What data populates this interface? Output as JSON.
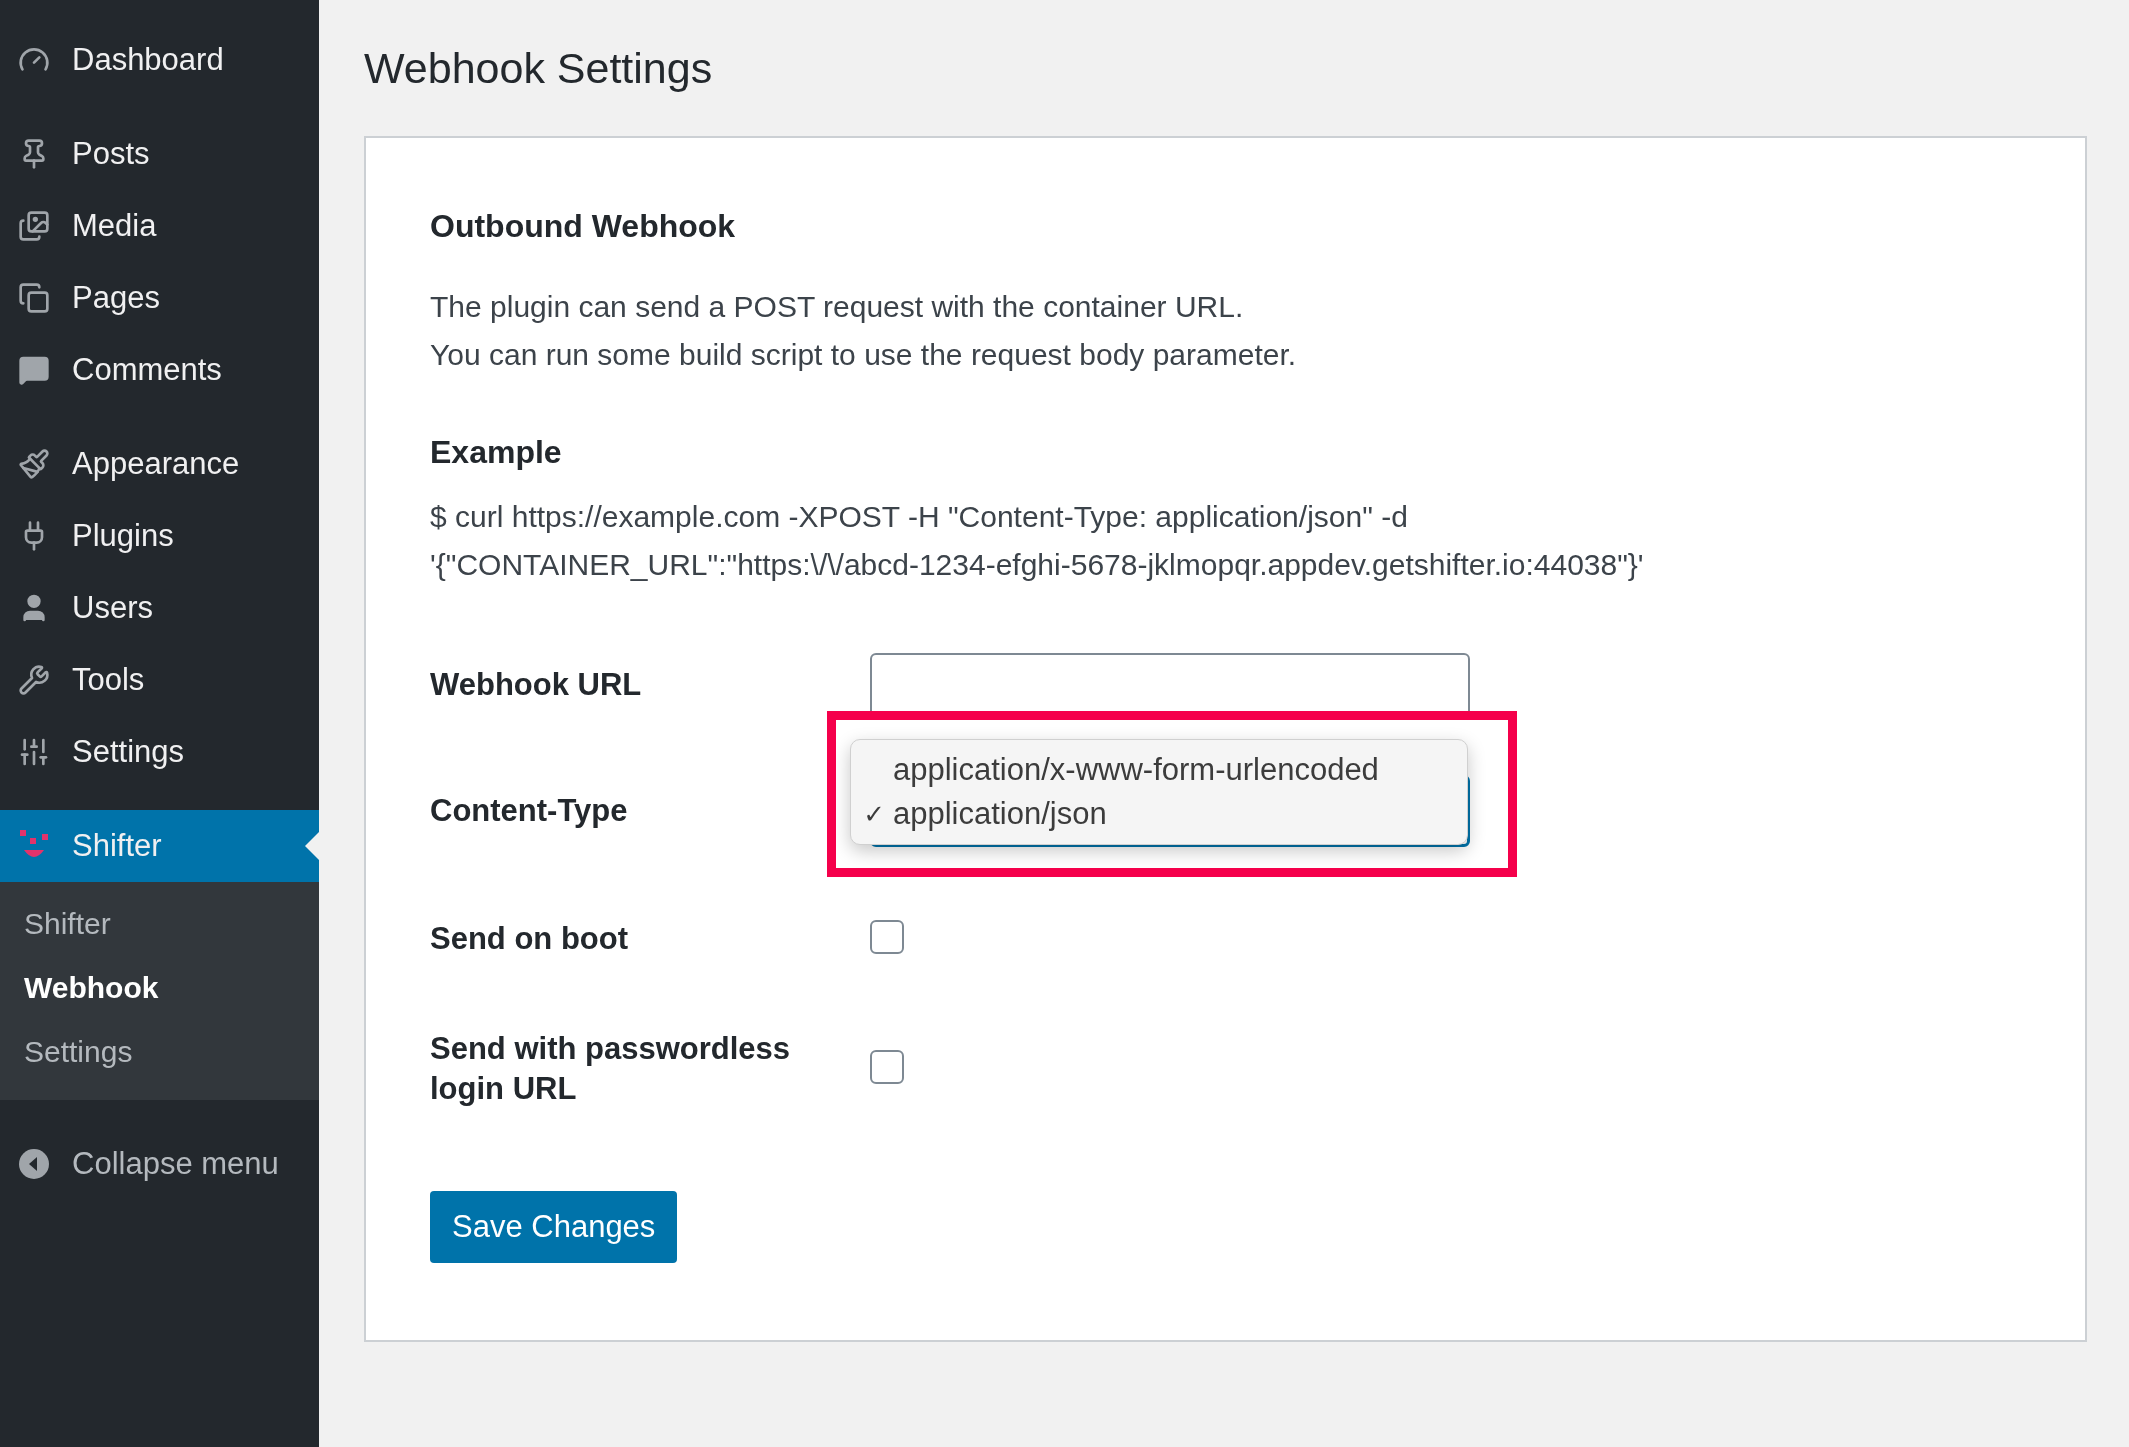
{
  "sidebar": {
    "groups": [
      {
        "items": [
          {
            "label": "Dashboard",
            "selected": false
          }
        ]
      },
      {
        "items": [
          {
            "label": "Posts",
            "selected": false
          },
          {
            "label": "Media",
            "selected": false
          },
          {
            "label": "Pages",
            "selected": false
          },
          {
            "label": "Comments",
            "selected": false
          }
        ]
      },
      {
        "items": [
          {
            "label": "Appearance",
            "selected": false
          },
          {
            "label": "Plugins",
            "selected": false
          },
          {
            "label": "Users",
            "selected": false
          },
          {
            "label": "Tools",
            "selected": false
          },
          {
            "label": "Settings",
            "selected": false
          }
        ]
      },
      {
        "items": [
          {
            "label": "Shifter",
            "selected": true,
            "children": [
              {
                "label": "Shifter",
                "selected": false
              },
              {
                "label": "Webhook",
                "selected": true
              },
              {
                "label": "Settings",
                "selected": false
              }
            ]
          }
        ]
      }
    ],
    "collapse": "Collapse menu"
  },
  "page": {
    "title": "Webhook Settings",
    "card": {
      "heading": "Outbound Webhook",
      "description": [
        "The plugin can send a POST request with the container URL.",
        "You can run some build script to use the request body parameter."
      ],
      "example_heading": "Example",
      "example_lines": [
        "$ curl https://example.com -XPOST -H \"Content-Type: application/json\" -d",
        "'{\"CONTAINER_URL\":\"https:\\/\\/abcd-1234-efghi-5678-jklmopqr.appdev.getshifter.io:44038\"}'"
      ],
      "fields": [
        {
          "kind": "text",
          "label": "Webhook URL"
        },
        {
          "kind": "select",
          "label": "Content-Type",
          "expanded": true,
          "check_mark": "✓",
          "options": [
            {
              "label": "application/x-www-form-urlencoded",
              "selected": false
            },
            {
              "label": "application/json",
              "selected": true
            }
          ]
        },
        {
          "kind": "checkbox",
          "label": "Send on boot",
          "checked": false
        },
        {
          "kind": "checkbox",
          "label": "Send with passwordless login URL",
          "checked": false
        }
      ],
      "save_button": "Save Changes"
    }
  }
}
